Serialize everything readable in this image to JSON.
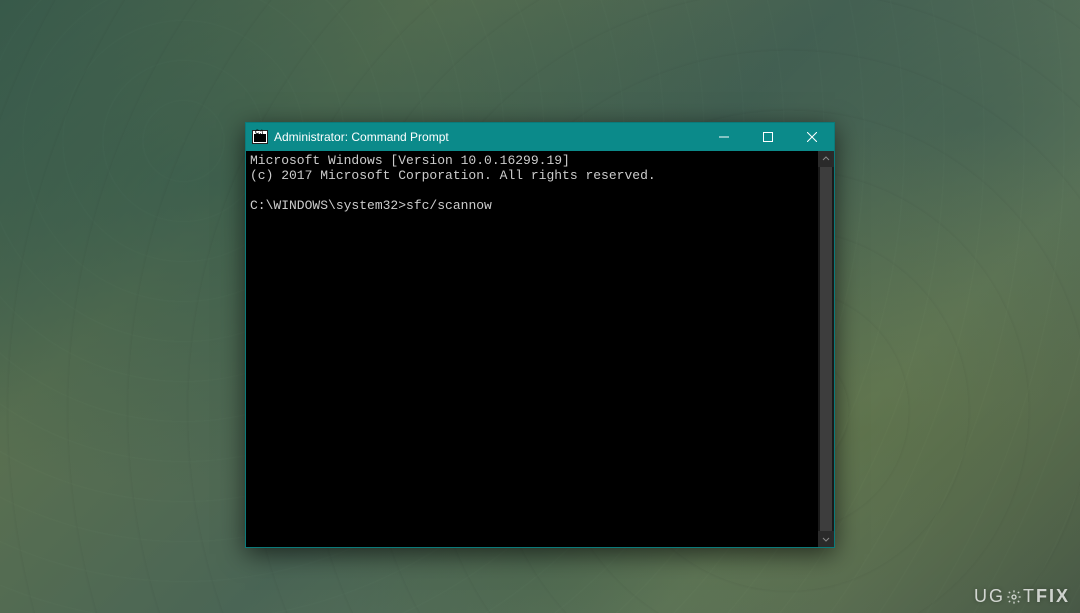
{
  "window": {
    "title": "Administrator: Command Prompt"
  },
  "terminal": {
    "line1": "Microsoft Windows [Version 10.0.16299.19]",
    "line2": "(c) 2017 Microsoft Corporation. All rights reserved.",
    "blank": "",
    "prompt": "C:\\WINDOWS\\system32>",
    "command": "sfc/scannow"
  },
  "watermark": {
    "part1": "UG",
    "part2": "T",
    "part3": "FIX"
  }
}
